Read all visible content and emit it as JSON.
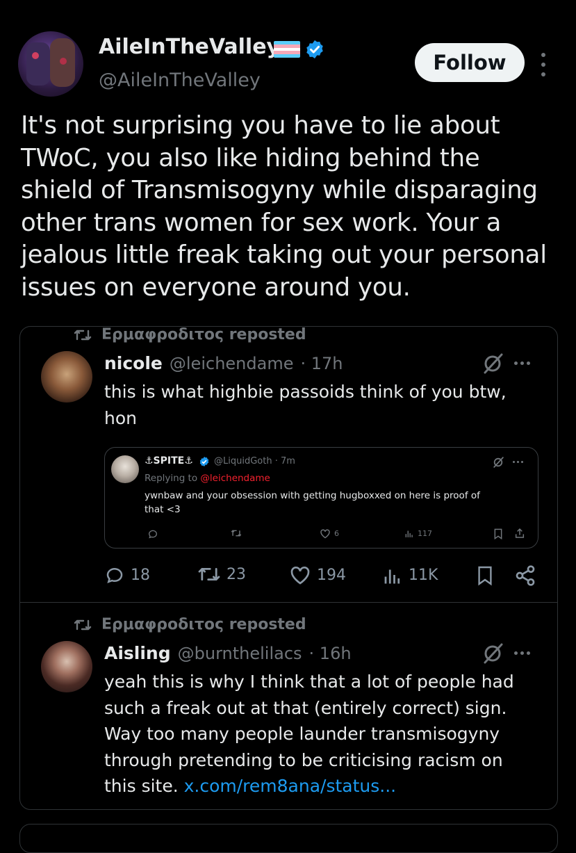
{
  "author": {
    "display_name": "AileInTheValley",
    "handle": "@AileInTheValley",
    "follow_label": "Follow"
  },
  "tweet": {
    "text": "It's not surprising you have to lie about\nTWoC, you also like hiding behind the\nshield of Transmisogyny while disparaging\nother trans women for sex work. Your a\njealous little freak taking out your personal\nissues on everyone around you."
  },
  "colors": {
    "background": "#000000",
    "text": "#e7e9ea",
    "secondary_text": "#71767b",
    "link": "#1d9bf0",
    "verified": "#1d9bf0",
    "follow_bg": "#eff3f4",
    "trans_flag": [
      "#5bcefa",
      "#f5a9b8",
      "#ffffff",
      "#f5a9b8",
      "#5bcefa"
    ]
  },
  "feed": [
    {
      "repost_label": "Ερμαφροδιτος reposted",
      "name": "nicole",
      "handle": "@leichendame",
      "time": "· 17h",
      "text": "this is what highbie passoids think of you btw,\nhon",
      "quoted": {
        "name": "⚓SPITE⚓",
        "handle": "@LiquidGoth · 7m",
        "replying_prefix": "Replying to ",
        "replying_to": "@leichendame",
        "text": "ywnbaw and your obsession with getting hugboxxed on here is proof of\nthat <3",
        "likes": "6",
        "views": "117"
      },
      "actions": {
        "replies": "18",
        "reposts": "23",
        "likes": "194",
        "views": "11K"
      }
    },
    {
      "repost_label": "Ερμαφροδιτος reposted",
      "name": "Aisling",
      "handle": "@burnthelilacs",
      "time": "· 16h",
      "text": "yeah this is why I think that a lot of people had\nsuch a freak out at that (entirely correct) sign.\nWay too many people launder transmisogyny\nthrough pretending to be criticising racism on\nthis site. ",
      "link": "x.com/rem8ana/status..."
    }
  ],
  "icons": [
    "verified-badge-icon",
    "trans-flag-icon",
    "more-options-icon",
    "repost-icon",
    "grok-icon",
    "reply-icon",
    "like-icon",
    "views-icon",
    "bookmark-icon",
    "share-icon"
  ]
}
